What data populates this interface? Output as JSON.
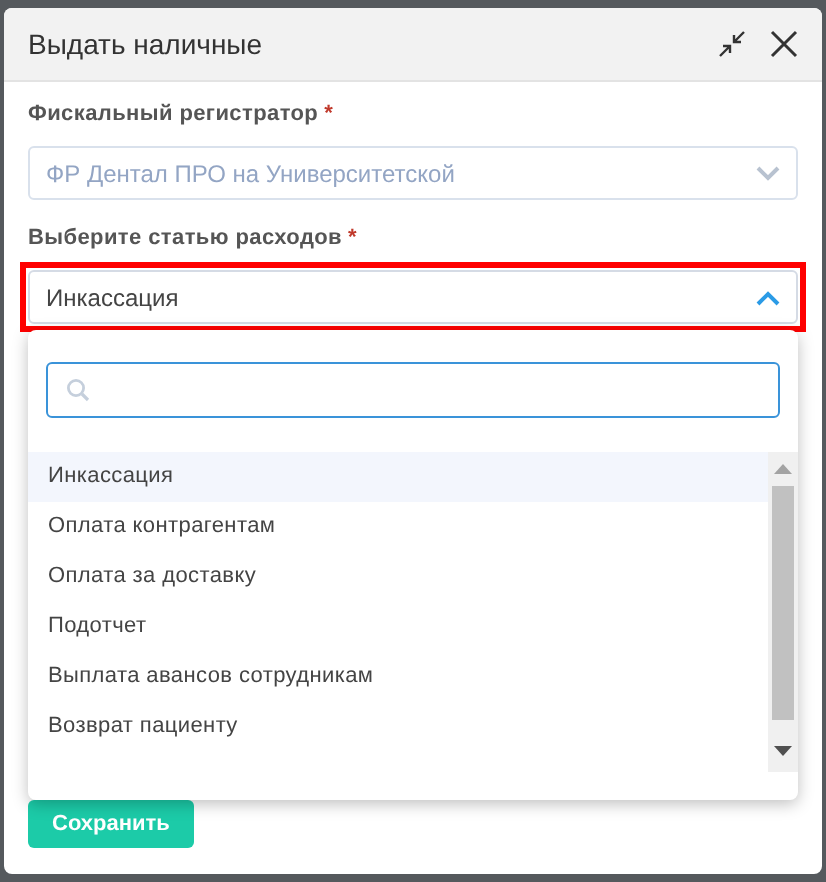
{
  "dialog": {
    "title": "Выдать наличные"
  },
  "fields": [
    {
      "label": "Фискальный регистратор",
      "required_mark": "*",
      "value": "ФР Дентал ПРО на Университетской",
      "disabled": true,
      "expanded": false,
      "highlighted": false
    },
    {
      "label": "Выберите статью расходов",
      "required_mark": "*",
      "value": "Инкассация",
      "disabled": false,
      "expanded": true,
      "highlighted": true
    }
  ],
  "options": [
    {
      "label": "Инкассация",
      "selected": true
    },
    {
      "label": "Оплата контрагентам",
      "selected": false
    },
    {
      "label": "Оплата за доставку",
      "selected": false
    },
    {
      "label": "Подотчет",
      "selected": false
    },
    {
      "label": "Выплата авансов сотрудникам",
      "selected": false
    },
    {
      "label": "Возврат пациенту",
      "selected": false
    }
  ],
  "buttons": [
    {
      "label": "Сохранить"
    }
  ]
}
